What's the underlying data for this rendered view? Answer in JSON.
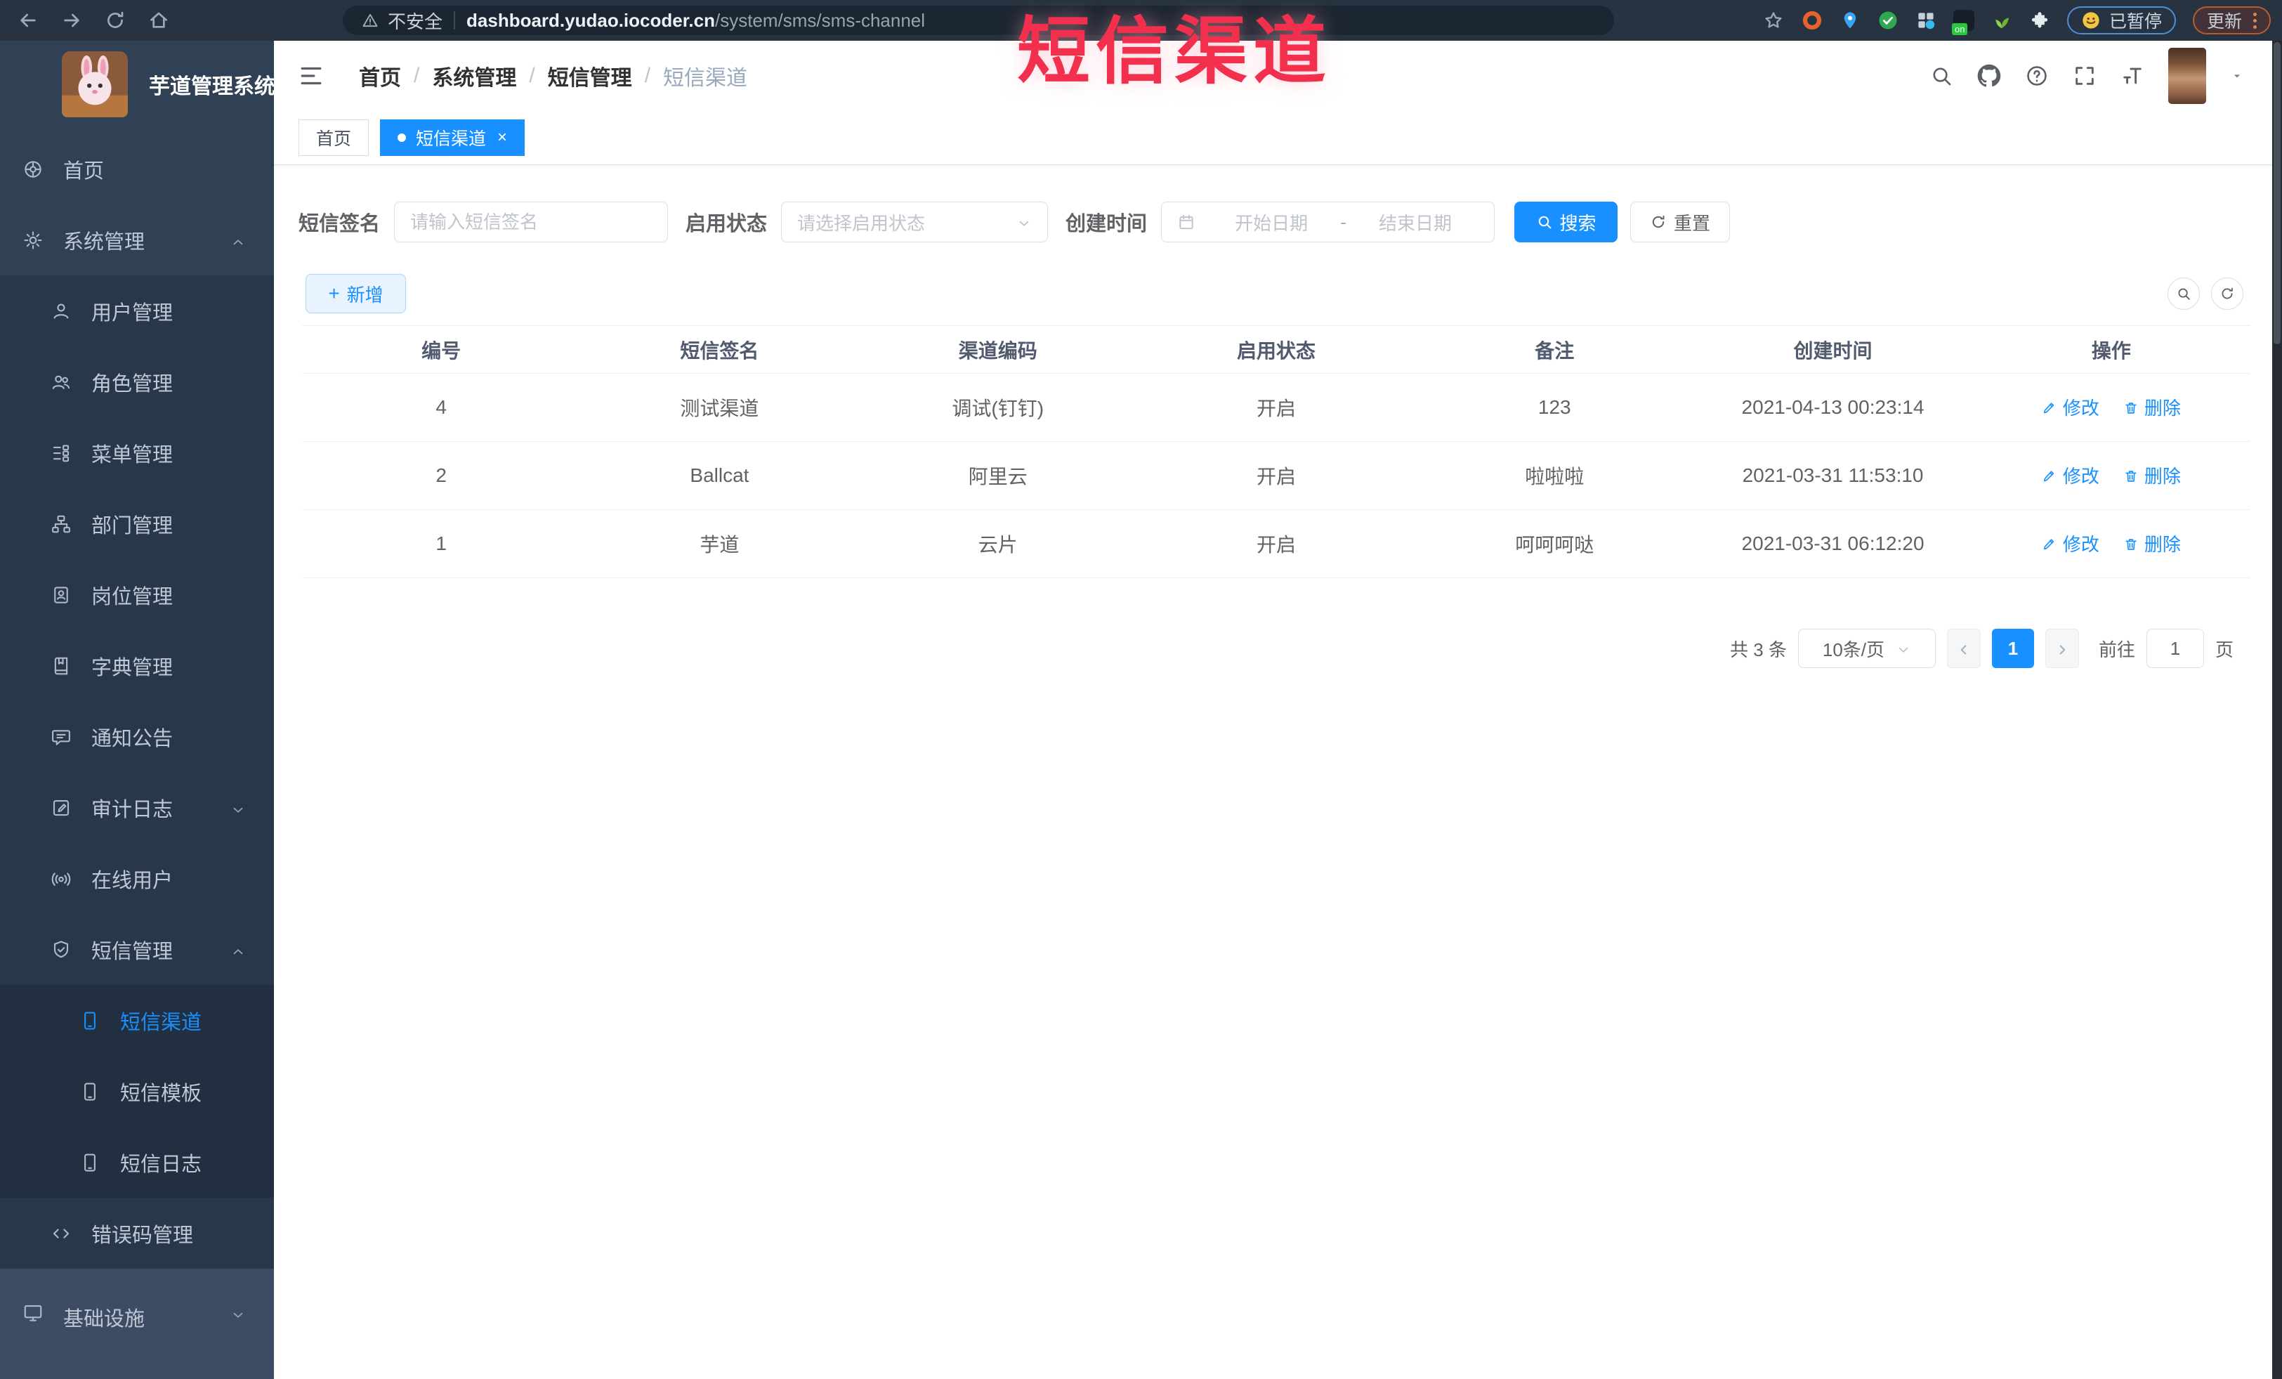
{
  "browser": {
    "security_label": "不安全",
    "url_domain": "dashboard.yudao.iocoder.cn",
    "url_path": "/system/sms/sms-channel",
    "ext_badge": "on",
    "paused_label": "已暂停",
    "update_label": "更新"
  },
  "overlay": {
    "title": "短信渠道"
  },
  "sidebar": {
    "app_title": "芋道管理系统",
    "items": [
      {
        "label": "首页",
        "icon": "home-dashboard-icon",
        "depth": 0
      },
      {
        "label": "系统管理",
        "icon": "gear-icon",
        "depth": 0,
        "arrow": "up"
      },
      {
        "label": "用户管理",
        "icon": "user-icon",
        "depth": 1
      },
      {
        "label": "角色管理",
        "icon": "role-users-icon",
        "depth": 1
      },
      {
        "label": "菜单管理",
        "icon": "menu-list-icon",
        "depth": 1
      },
      {
        "label": "部门管理",
        "icon": "org-tree-icon",
        "depth": 1
      },
      {
        "label": "岗位管理",
        "icon": "post-badge-icon",
        "depth": 1
      },
      {
        "label": "字典管理",
        "icon": "dictionary-book-icon",
        "depth": 1
      },
      {
        "label": "通知公告",
        "icon": "notice-message-icon",
        "depth": 1
      },
      {
        "label": "审计日志",
        "icon": "audit-log-icon",
        "depth": 1,
        "arrow": "down"
      },
      {
        "label": "在线用户",
        "icon": "online-users-icon",
        "depth": 1
      },
      {
        "label": "短信管理",
        "icon": "sms-shield-icon",
        "depth": 1,
        "arrow": "up"
      },
      {
        "label": "短信渠道",
        "icon": "phone-icon",
        "depth": 2,
        "active": true
      },
      {
        "label": "短信模板",
        "icon": "phone-icon",
        "depth": 2
      },
      {
        "label": "短信日志",
        "icon": "phone-icon",
        "depth": 2
      },
      {
        "label": "错误码管理",
        "icon": "code-icon",
        "depth": 1
      },
      {
        "label": "基础设施",
        "icon": "infrastructure-icon",
        "depth": 0,
        "arrow": "down",
        "highlighted": true
      }
    ]
  },
  "header": {
    "breadcrumb": [
      "首页",
      "系统管理",
      "短信管理",
      "短信渠道"
    ],
    "separator": "/"
  },
  "tabs": [
    {
      "label": "首页",
      "active": false
    },
    {
      "label": "短信渠道",
      "active": true,
      "close": "×"
    }
  ],
  "filters": {
    "signature_label": "短信签名",
    "signature_placeholder": "请输入短信签名",
    "status_label": "启用状态",
    "status_placeholder": "请选择启用状态",
    "created_label": "创建时间",
    "date_start_placeholder": "开始日期",
    "date_separator": "-",
    "date_end_placeholder": "结束日期",
    "search_label": "搜索",
    "reset_label": "重置"
  },
  "toolbar": {
    "add_label": "新增"
  },
  "table": {
    "columns": [
      "编号",
      "短信签名",
      "渠道编码",
      "启用状态",
      "备注",
      "创建时间",
      "操作"
    ],
    "rows": [
      [
        "4",
        "测试渠道",
        "调试(钉钉)",
        "开启",
        "123",
        "2021-04-13 00:23:14"
      ],
      [
        "2",
        "Ballcat",
        "阿里云",
        "开启",
        "啦啦啦",
        "2021-03-31 11:53:10"
      ],
      [
        "1",
        "芋道",
        "云片",
        "开启",
        "呵呵呵哒",
        "2021-03-31 06:12:20"
      ]
    ],
    "edit_label": "修改",
    "delete_label": "删除"
  },
  "pagination": {
    "total_label": "共 3 条",
    "page_size_label": "10条/页",
    "current_page": "1",
    "goto_label": "前往",
    "goto_value": "1",
    "unit_label": "页"
  },
  "colors": {
    "accent": "#1890ff",
    "sidebar_bg": "#304156",
    "overlay_red": "#f2304d",
    "active_tab": "#1890ff"
  }
}
